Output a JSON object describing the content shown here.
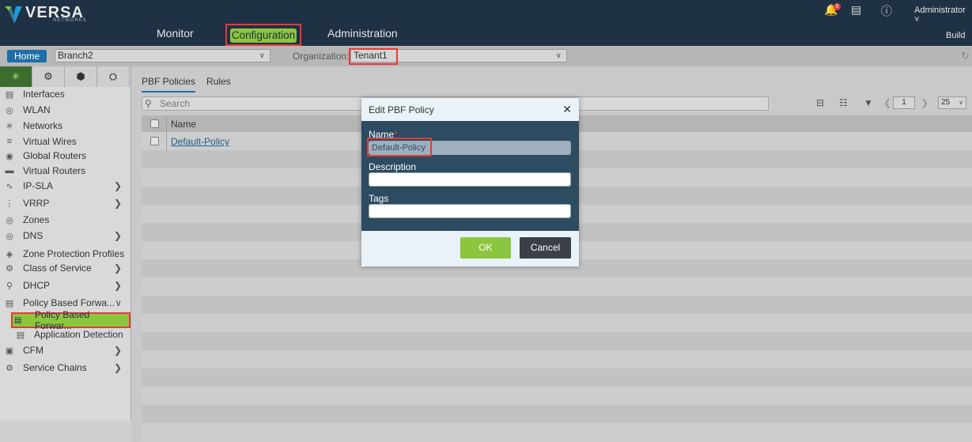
{
  "topbar": {
    "logo_text": "VERSA",
    "logo_sub": "NETWORKS",
    "nav": {
      "monitor": "Monitor",
      "configuration": "Configuration",
      "administration": "Administration"
    },
    "notification_count": "0",
    "user": "Administrator",
    "build": "Build",
    "accent_color": "#8cc63f"
  },
  "context": {
    "home": "Home",
    "appliance": "Branch2",
    "org_label": "Organization:",
    "org_value": "Tenant1"
  },
  "sidebar": {
    "items": [
      {
        "label": "Interfaces",
        "icon": "interfaces-icon"
      },
      {
        "label": "WLAN",
        "icon": "wlan-icon"
      },
      {
        "label": "Networks",
        "icon": "networks-icon"
      },
      {
        "label": "Virtual Wires",
        "icon": "virtual-wires-icon"
      },
      {
        "label": "Global Routers",
        "icon": "global-routers-icon"
      },
      {
        "label": "Virtual Routers",
        "icon": "virtual-routers-icon"
      },
      {
        "label": "IP-SLA",
        "icon": "ip-sla-icon"
      },
      {
        "label": "VRRP",
        "icon": "vrrp-icon"
      },
      {
        "label": "Zones",
        "icon": "zones-icon"
      },
      {
        "label": "DNS",
        "icon": "dns-icon"
      },
      {
        "label": "Zone Protection Profiles",
        "icon": "zone-protection-icon"
      },
      {
        "label": "Class of Service",
        "icon": "class-of-service-icon"
      },
      {
        "label": "DHCP",
        "icon": "dhcp-icon"
      },
      {
        "label": "Policy Based Forwa...",
        "icon": "pbf-icon"
      },
      {
        "label": "Policy Based Forwar...",
        "icon": "pbf-policy-icon"
      },
      {
        "label": "Application Detection",
        "icon": "app-detection-icon"
      },
      {
        "label": "CFM",
        "icon": "cfm-icon"
      },
      {
        "label": "Service Chains",
        "icon": "service-chains-icon"
      }
    ]
  },
  "main": {
    "tabs": [
      "PBF Policies",
      "Rules"
    ],
    "search_placeholder": "Search",
    "page_number": "1",
    "page_size": "25",
    "column_name": "Name",
    "rows": [
      "Default-Policy"
    ]
  },
  "modal": {
    "title": "Edit PBF Policy",
    "name_label": "Name",
    "name_required": "*",
    "name_value": "Default-Policy",
    "description_label": "Description",
    "description_value": "",
    "tags_label": "Tags",
    "tags_value": "",
    "ok": "OK",
    "cancel": "Cancel"
  }
}
